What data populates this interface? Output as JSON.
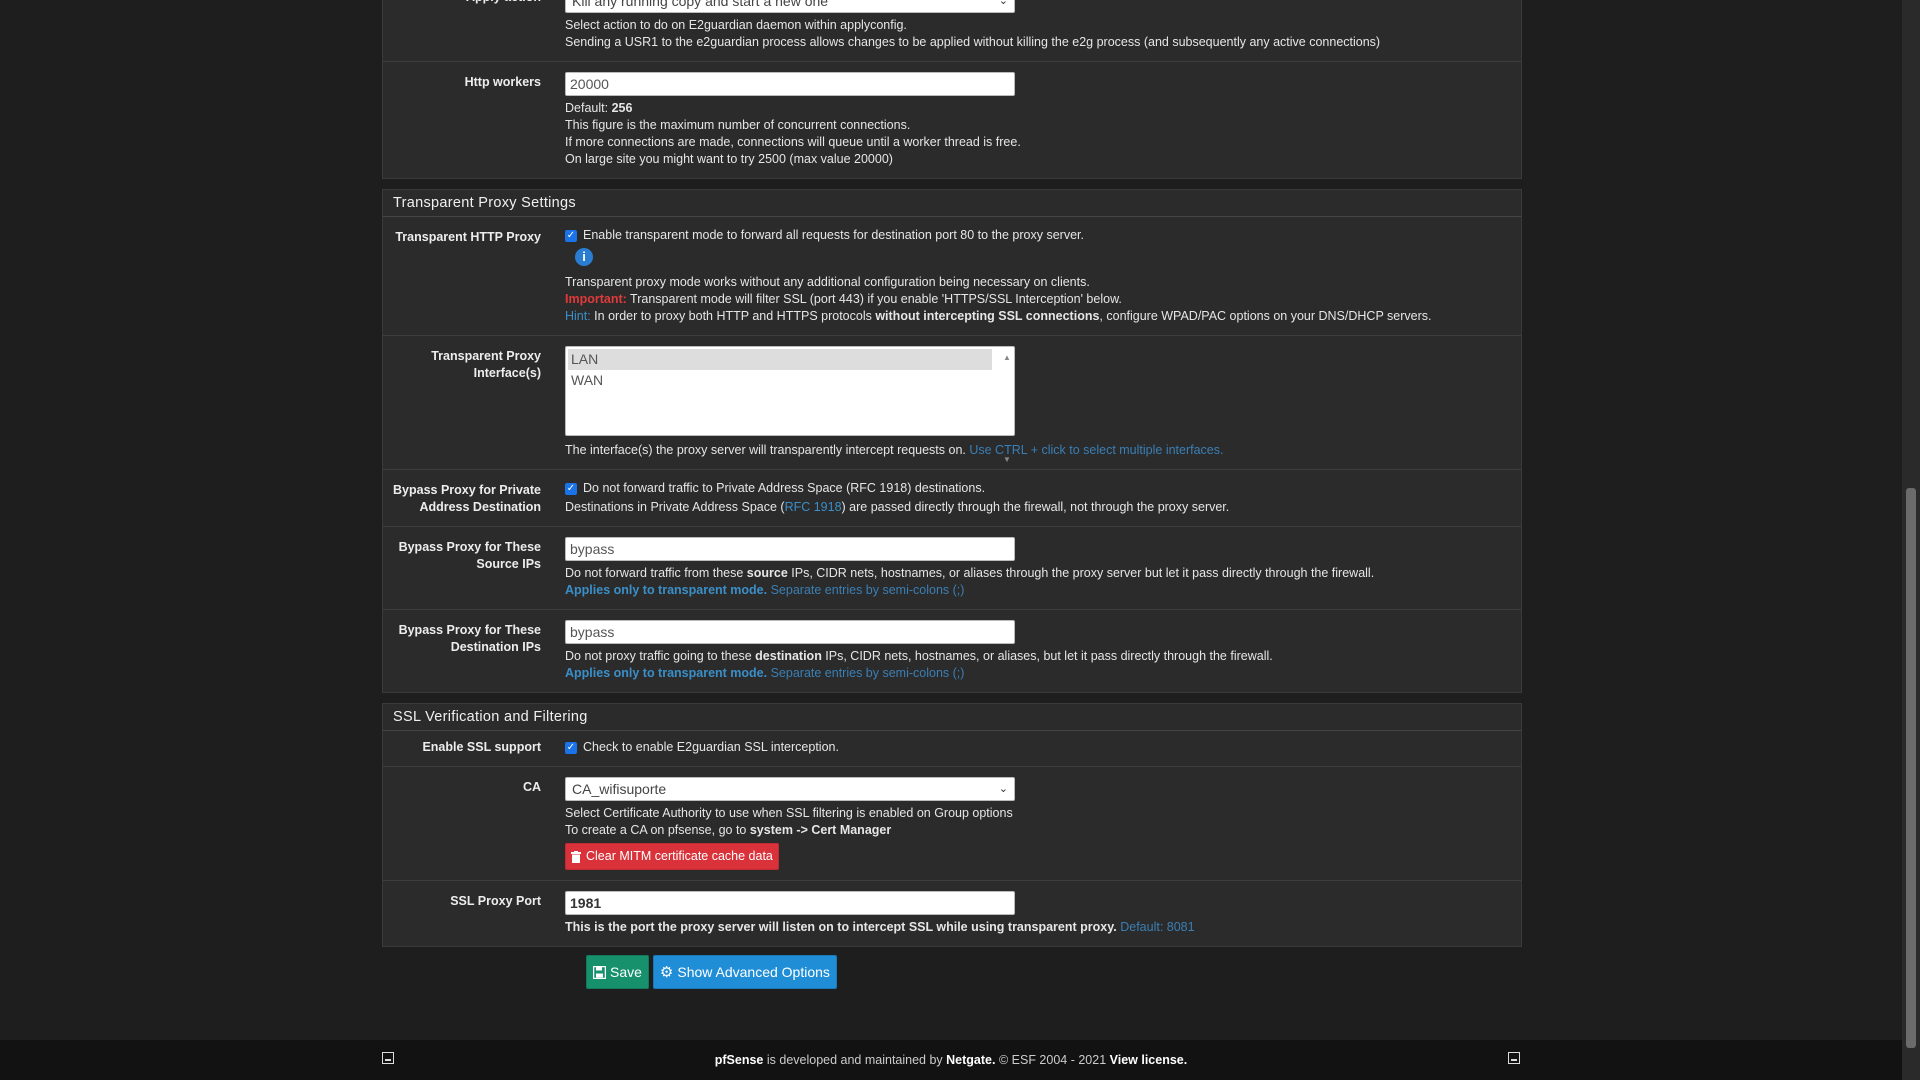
{
  "apply": {
    "label": "Apply action",
    "value": "Kill any running copy and start a new one",
    "help1": "Select action to do on E2guardian daemon within applyconfig.",
    "help2": "Sending a USR1 to the e2guardian process allows changes to be applied without killing the e2g process (and subsequently any active connections)"
  },
  "http_workers": {
    "label": "Http workers",
    "value": "20000",
    "default_label": "Default: ",
    "default_value": "256",
    "help1": "This figure is the maximum number of concurrent connections.",
    "help2": "If more connections are made, connections will queue until a worker thread is free.",
    "help3": "On large site you might want to try 2500 (max value 20000)"
  },
  "transparent": {
    "section_title": "Transparent Proxy Settings",
    "http_proxy": {
      "label": "Transparent HTTP Proxy",
      "checkbox_text": "Enable transparent mode to forward all requests for destination port 80 to the proxy server.",
      "help1": "Transparent proxy mode works without any additional configuration being necessary on clients.",
      "important_label": "Important:",
      "important_text": " Transparent mode will filter SSL (port 443) if you enable 'HTTPS/SSL Interception' below.",
      "hint_label": "Hint:",
      "hint_text_a": " In order to proxy both HTTP and HTTPS protocols ",
      "hint_bold": "without intercepting SSL connections",
      "hint_text_b": ", configure WPAD/PAC options on your DNS/DHCP servers."
    },
    "interfaces": {
      "label": "Transparent Proxy Interface(s)",
      "options": [
        "LAN",
        "WAN"
      ],
      "help": "The interface(s) the proxy server will transparently intercept requests on. ",
      "help_link": "Use CTRL + click to select multiple interfaces."
    },
    "bypass_private": {
      "label": "Bypass Proxy for Private Address Destination",
      "checkbox_text": "Do not forward traffic to Private Address Space (RFC 1918) destinations.",
      "help_a": "Destinations in Private Address Space (",
      "help_link": "RFC 1918",
      "help_b": ") are passed directly through the firewall, not through the proxy server."
    },
    "bypass_source": {
      "label": "Bypass Proxy for These Source IPs",
      "value": "bypass",
      "help_a": "Do not forward traffic from these ",
      "help_bold": "source",
      "help_b": " IPs, CIDR nets, hostnames, or aliases through the proxy server but let it pass directly through the firewall.",
      "applies": "Applies only to transparent mode.",
      "separate": " Separate entries by semi-colons (;)"
    },
    "bypass_dest": {
      "label": "Bypass Proxy for These Destination IPs",
      "value": "bypass",
      "help_a": "Do not proxy traffic going to these ",
      "help_bold": "destination",
      "help_b": " IPs, CIDR nets, hostnames, or aliases, but let it pass directly through the firewall.",
      "applies": "Applies only to transparent mode.",
      "separate": " Separate entries by semi-colons (;)"
    }
  },
  "ssl": {
    "section_title": "SSL Verification and Filtering",
    "enable": {
      "label": "Enable SSL support",
      "checkbox_text": "Check to enable E2guardian SSL interception."
    },
    "ca": {
      "label": "CA",
      "value": "CA_wifisuporte",
      "help1": "Select Certificate Authority to use when SSL filtering is enabled on Group options",
      "help2_a": "To create a CA on pfsense, go to ",
      "help2_bold": "system -> Cert Manager",
      "clear_button": "Clear MITM certificate cache data"
    },
    "port": {
      "label": "SSL Proxy Port",
      "value": "1981",
      "help": "This is the port the proxy server will listen on to intercept SSL while using transparent proxy. ",
      "default": "Default: 8081"
    }
  },
  "buttons": {
    "save": "Save",
    "advanced": "Show Advanced Options"
  },
  "footer": {
    "brand": "pfSense",
    "text_a": " is developed and maintained by ",
    "company": "Netgate.",
    "text_b": " © ESF 2004 - 2021 ",
    "license": "View license."
  }
}
